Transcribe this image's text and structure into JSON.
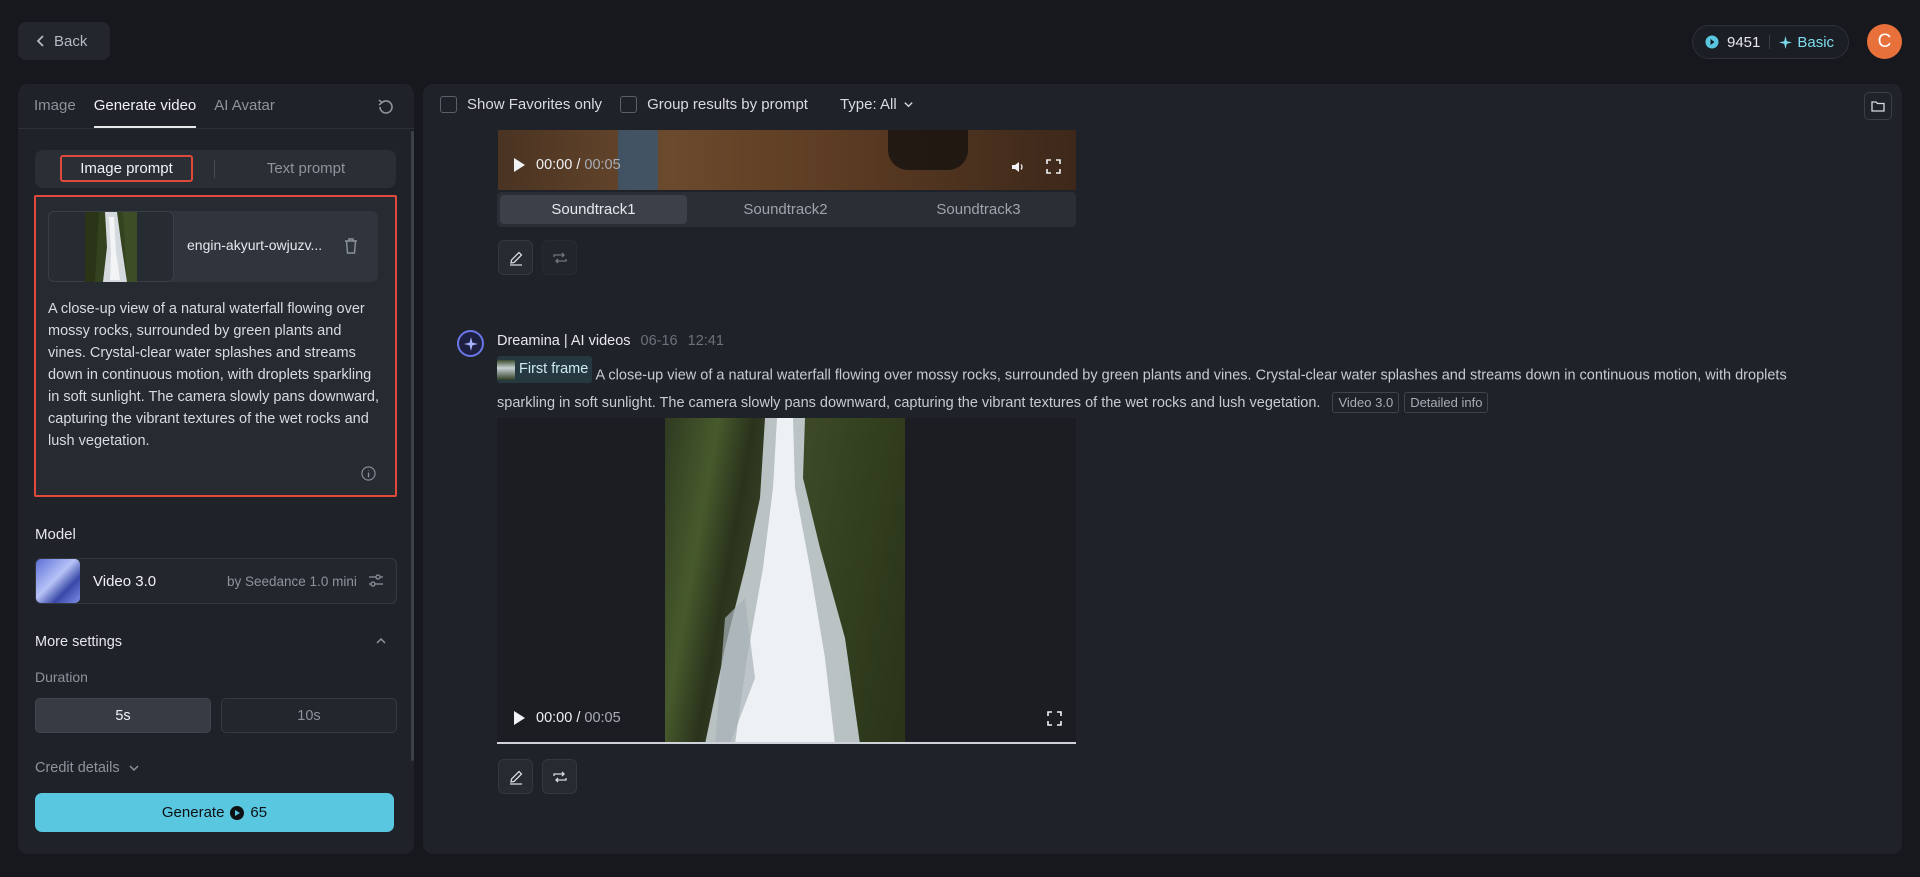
{
  "header": {
    "back_label": "Back",
    "credits": "9451",
    "plan": "Basic",
    "avatar_letter": "C"
  },
  "left": {
    "tabs": [
      {
        "label": "Image"
      },
      {
        "label": "Generate video"
      },
      {
        "label": "AI Avatar"
      }
    ],
    "prompt_modes": {
      "image": "Image prompt",
      "text": "Text prompt"
    },
    "file_name": "engin-akyurt-owjuzv...",
    "prompt_text": "A close-up view of a natural waterfall flowing over mossy rocks, surrounded by green plants and vines. Crystal-clear water splashes and streams down in continuous motion, with droplets sparkling in soft sunlight. The camera slowly pans downward, capturing the vibrant textures of the wet rocks and lush vegetation.",
    "model_label": "Model",
    "model_name": "Video 3.0",
    "model_by": "by Seedance 1.0 mini",
    "more_settings": "More settings",
    "duration_label": "Duration",
    "durations": [
      "5s",
      "10s"
    ],
    "credit_details": "Credit details",
    "generate_label": "Generate",
    "generate_cost": "65"
  },
  "toolbar": {
    "favorites": "Show Favorites only",
    "group": "Group results by prompt",
    "type": "Type: All"
  },
  "feed": {
    "video1": {
      "time": "00:00",
      "sep": "/",
      "duration": "00:05"
    },
    "soundtracks": [
      "Soundtrack1",
      "Soundtrack2",
      "Soundtrack3"
    ],
    "message": {
      "sender": "Dreamina | AI videos",
      "date": "06-16",
      "time": "12:41",
      "first_frame": "First frame",
      "text": "A close-up view of a natural waterfall flowing over mossy rocks, surrounded by green plants and vines. Crystal-clear water splashes and streams down in continuous motion, with droplets sparkling in soft sunlight. The camera slowly pans downward, capturing the vibrant textures of the wet rocks and lush vegetation.",
      "tag_model": "Video 3.0",
      "tag_info": "Detailed info"
    },
    "video2": {
      "time": "00:00",
      "sep": "/",
      "duration": "00:05"
    }
  },
  "colors": {
    "accent": "#5ac7e0",
    "highlight": "#e04a3a",
    "avatar": "#e8703a"
  }
}
